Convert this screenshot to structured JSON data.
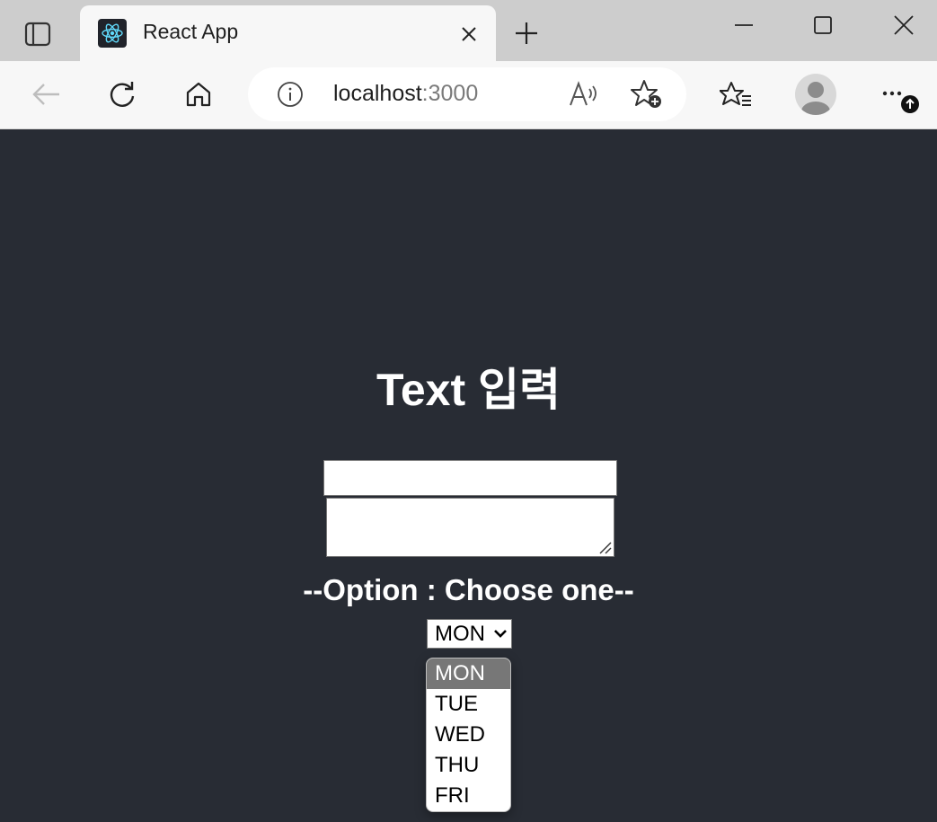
{
  "browser": {
    "tab": {
      "title": "React App",
      "favicon": "react-logo-icon"
    },
    "address": {
      "host": "localhost",
      "port": ":3000"
    },
    "icons": {
      "tab_actions": "tab-actions-icon",
      "close": "close-icon",
      "new_tab": "plus-icon",
      "minimize": "minimize-icon",
      "maximize": "maximize-icon",
      "window_close": "close-icon",
      "back": "back-arrow-icon",
      "refresh": "refresh-icon",
      "home": "home-icon",
      "site_info": "info-icon",
      "read_aloud": "read-aloud-icon",
      "add_favorite": "add-favorite-icon",
      "favorites": "favorites-icon",
      "profile": "profile-icon",
      "more": "more-icon"
    },
    "read_aloud_glyph": "A)"
  },
  "page": {
    "heading": "Text 입력",
    "text_input_value": "",
    "textarea_value": "",
    "option_label": "--Option : Choose one--",
    "select": {
      "selected": "MON",
      "options": [
        "MON",
        "TUE",
        "WED",
        "THU",
        "FRI"
      ]
    }
  },
  "colors": {
    "page_background": "#282c34",
    "heading_text": "#ffffff",
    "dropdown_highlight": "#777777"
  }
}
